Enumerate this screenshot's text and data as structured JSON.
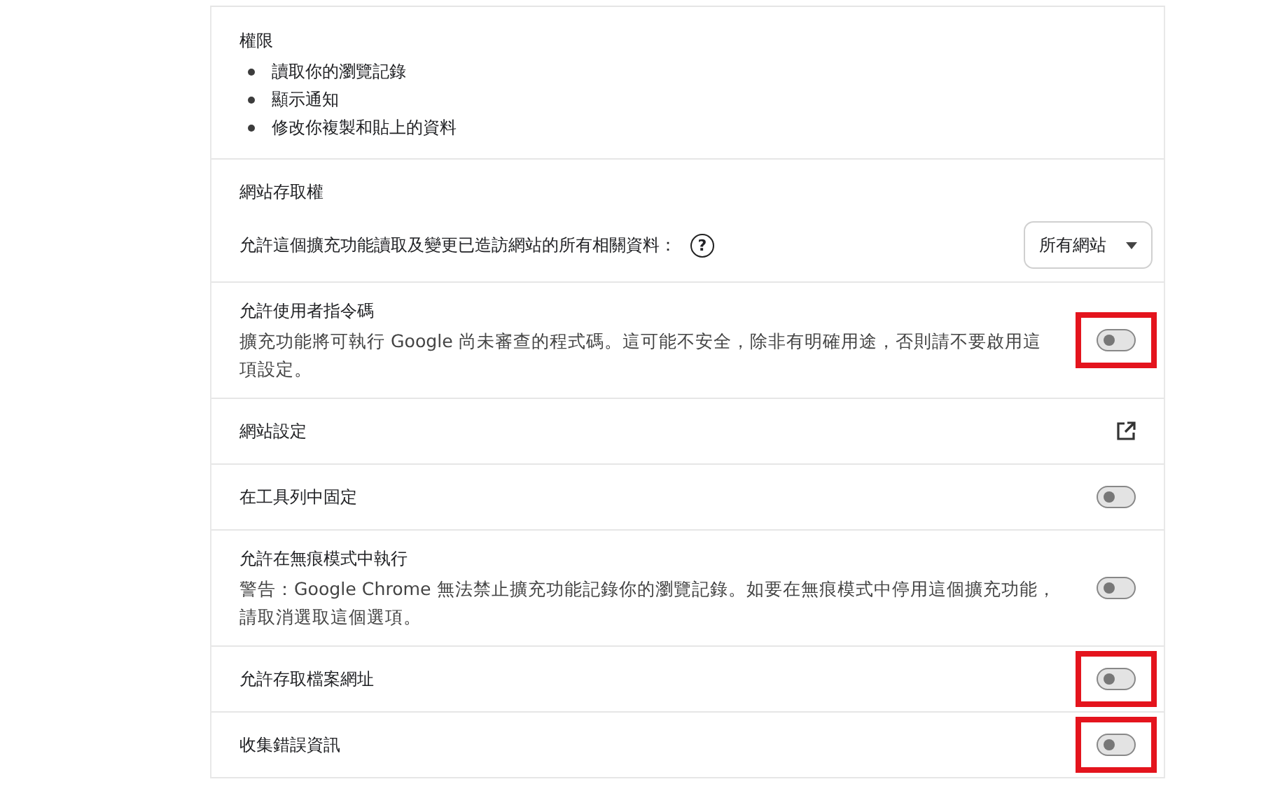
{
  "sections": [
    {
      "kind": "permissions",
      "title": "權限",
      "items": [
        "讀取你的瀏覽記錄",
        "顯示通知",
        "修改你複製和貼上的資料"
      ]
    },
    {
      "kind": "site_access",
      "title": "網站存取權",
      "label": "允許這個擴充功能讀取及變更已造訪網站的所有相關資料：",
      "help_icon": "?",
      "select": "所有網站"
    },
    {
      "kind": "toggle",
      "title": "允許使用者指令碼",
      "description": "擴充功能將可執行 Google 尚未審查的程式碼。這可能不安全，除非有明確用途，否則請不要啟用這項設定。",
      "on": false,
      "highlighted": true
    },
    {
      "kind": "link",
      "title": "網站設定"
    },
    {
      "kind": "toggle",
      "title": "在工具列中固定",
      "on": false,
      "highlighted": false
    },
    {
      "kind": "toggle",
      "title": "允許在無痕模式中執行",
      "description": "警告：Google Chrome 無法禁止擴充功能記錄你的瀏覽記錄。如要在無痕模式中停用這個擴充功能，請取消選取這個選項。",
      "on": false,
      "highlighted": false
    },
    {
      "kind": "toggle",
      "title": "允許存取檔案網址",
      "on": false,
      "highlighted": true
    },
    {
      "kind": "toggle",
      "title": "收集錯誤資訊",
      "on": false,
      "highlighted": true
    }
  ]
}
